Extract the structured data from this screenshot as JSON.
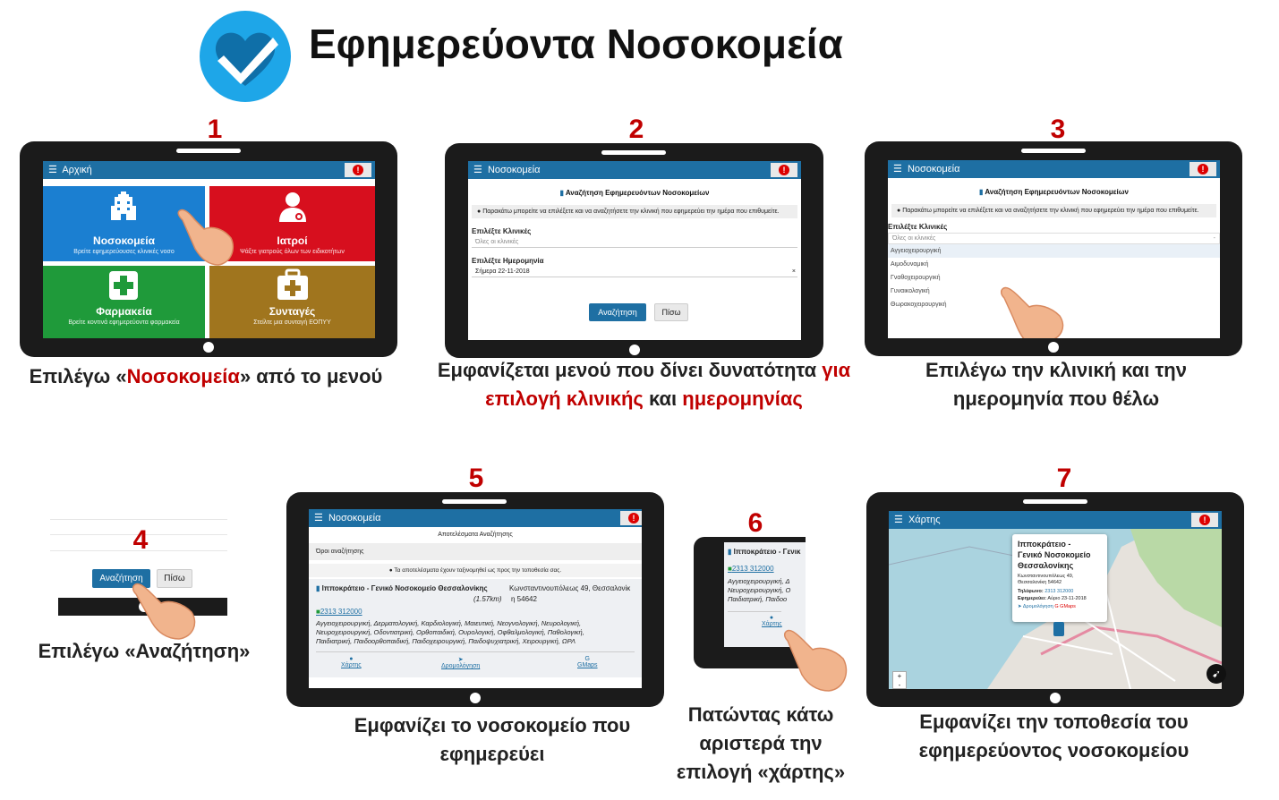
{
  "title": "Εφημερεύοντα Νοσοκομεία",
  "accent_red": "#c00000",
  "header_blue": "#1e6fa3",
  "steps": {
    "s1": {
      "num": "1",
      "header": "Αρχική",
      "tiles": [
        {
          "label": "Νοσοκομεία",
          "sub": "Βρείτε εφημερεύουσες κλινικές νοσο",
          "icon": "hospital-icon",
          "color": "#1b7fd1"
        },
        {
          "label": "Ιατροί",
          "sub": "Ψάξτε γιατρούς όλων των ειδικοτήτων",
          "icon": "doctor-icon",
          "color": "#d70f1e"
        },
        {
          "label": "Φαρμακεία",
          "sub": "Βρείτε κοντινά εφημερεύοντα φαρμακεία",
          "icon": "pharmacy-cross-icon",
          "color": "#1f9a3a"
        },
        {
          "label": "Συνταγές",
          "sub": "Στείλτε μια συνταγή ΕΟΠΥΥ",
          "icon": "medical-kit-icon",
          "color": "#a0751e"
        }
      ],
      "caption_a": "Επιλέγω «",
      "caption_b": "Νοσοκομεία",
      "caption_c": "» από το μενού"
    },
    "s2": {
      "num": "2",
      "header": "Νοσοκομεία",
      "subtitle": "Αναζήτηση Εφημερευόντων Νοσοκομείων",
      "info": "Παρακάτω μπορείτε να επιλέξετε και να αναζητήσετε την κλινική που εφημερεύει την ημέρα που επιθυμείτε.",
      "clinic_label": "Επιλέξτε Κλινικές",
      "clinic_placeholder": "Όλες οι κλινικές",
      "date_label": "Επιλέξτε Ημερομηνία",
      "date_value": "Σήμερα 22-11-2018",
      "clear": "×",
      "search": "Αναζήτηση",
      "back": "Πίσω",
      "caption_a": "Εμφανίζεται μενού που δίνει δυνατότητα ",
      "caption_b": "για",
      "caption_c": "επιλογή κλινικής",
      "caption_d": " και ",
      "caption_e": "ημερομηνίας"
    },
    "s3": {
      "num": "3",
      "header": "Νοσοκομεία",
      "subtitle": "Αναζήτηση Εφημερευόντων Νοσοκομείων",
      "info": "Παρακάτω μπορείτε να επιλέξετε και να αναζητήσετε την κλινική που εφημερεύει την ημέρα που επιθυμείτε.",
      "clinic_label": "Επιλέξτε Κλινικές",
      "clinic_placeholder": "Όλες οι κλινικές",
      "caret": "-",
      "options": [
        "Αγγειοχειρουργική",
        "Αιμοδυναμική",
        "Γναθοχειρουργική",
        "Γυναικολογική",
        "Θωρακοχειρουργική"
      ],
      "caption_a": "Επιλέγω την κλινική και την",
      "caption_b": "ημερομηνία που θέλω"
    },
    "s4": {
      "num": "4",
      "search": "Αναζήτηση",
      "back": "Πίσω",
      "caption": "Επιλέγω «Αναζήτηση»"
    },
    "s5": {
      "num": "5",
      "header": "Νοσοκομεία",
      "results_title": "Αποτελέσματα Αναζήτησης",
      "terms": "Όροι αναζήτησης",
      "sort_note": "Τα αποτελέσματα έχουν ταξινομηθεί ως προς την τοποθεσία σας.",
      "hospital": "Ιπποκράτειο - Γενικό Νοσοκομείο Θεσσαλονίκης",
      "address": "Κωνσταντινουπόλεως 49, Θεσσαλονίκ",
      "distance": "(1.57km)",
      "postcode": "η 54642",
      "phone": "2313 312000",
      "clinics_1": "Αγγειοχειρουργική, Δερματολογική, Καρδιολογική, Μαιευτική, Νεογνολογική, Νευρολογική,",
      "clinics_2": "Νευροχειρουργική, Οδοντιατρική, Ορθοπαιδική, Ουρολογική, Οφθαλμολογική, Παθολογική,",
      "clinics_3": "Παιδιατρική, Παιδοορθοπαιδική, Παιδοχειρουργική, Παιδοψυχιατρική, Χειρουργική, ΩΡΛ",
      "map": "Χάρτης",
      "route": "Δρομολόγηση",
      "gmaps": "GMaps",
      "caption_a": "Εμφανίζει το νοσοκομείο που",
      "caption_b": "εφημερεύει"
    },
    "s6": {
      "num": "6",
      "hospital": "Ιπποκράτειο - Γενικ",
      "phone": "2313 312000",
      "clinics_1": "Αγγειοχειρουργική, Δ",
      "clinics_2": "Νευροχειρουργική, Ο",
      "clinics_3": "Παιδιατρική, Παιδοο",
      "map": "Χάρτης",
      "caption_a": "Πατώντας κάτω",
      "caption_b": "αριστερά την",
      "caption_c": "επιλογή «χάρτης»"
    },
    "s7": {
      "num": "7",
      "header": "Χάρτης",
      "popup_title_1": "Ιπποκράτειο -",
      "popup_title_2": "Γενικό Νοσοκομείο",
      "popup_title_3": "Θεσσαλονίκης",
      "popup_addr_1": "Κωνσταντινουπόλεως 49,",
      "popup_addr_2": "Θεσσαλονίκη 54642",
      "phone_label": "Τηλέφωνο:",
      "phone": "2313 312000",
      "duty_label": "Εφημερεύει:",
      "duty": "Αύριο 23-11-2018",
      "route": "Δρομολόγηση",
      "gmaps": "GMaps",
      "zoom_in": "+",
      "zoom_out": "-",
      "caption_a": "Εμφανίζει την τοποθεσία του",
      "caption_b": "εφημερεύοντος νοσοκομείου"
    }
  }
}
